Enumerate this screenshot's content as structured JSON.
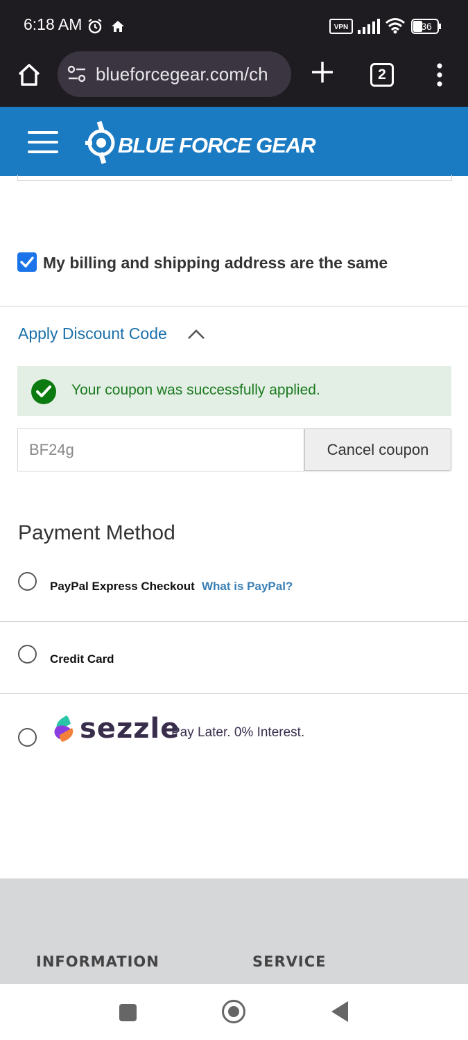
{
  "status_bar": {
    "time": "6:18 AM",
    "vpn_label": "VPN",
    "battery": "36",
    "icons": [
      "alarm-icon",
      "home-small-icon",
      "vpn-icon",
      "signal-icon",
      "wifi-icon",
      "battery-icon"
    ]
  },
  "browser": {
    "url": "blueforcegear.com/ch",
    "tab_count": "2",
    "icons": [
      "home-icon",
      "site-info-icon",
      "new-tab-icon",
      "tabs-icon",
      "more-menu-icon"
    ]
  },
  "header": {
    "brand": "BLUE FORCE GEAR",
    "brand_color": "#1a7ac2"
  },
  "billing": {
    "same_address_label": "My billing and shipping address are the same",
    "checked": true
  },
  "discount": {
    "toggle_label": "Apply Discount Code",
    "success_message": "Your coupon was successfully applied.",
    "coupon_value": "BF24g",
    "cancel_label": "Cancel coupon"
  },
  "payment": {
    "title": "Payment Method",
    "options": [
      {
        "label": "PayPal Express Checkout",
        "link": "What is PayPal?"
      },
      {
        "label": "Credit Card"
      },
      {
        "label": "sezzle",
        "tagline": "Pay Later. 0% Interest."
      }
    ]
  },
  "footer": {
    "information": "INFORMATION",
    "service": "SERVICE"
  }
}
